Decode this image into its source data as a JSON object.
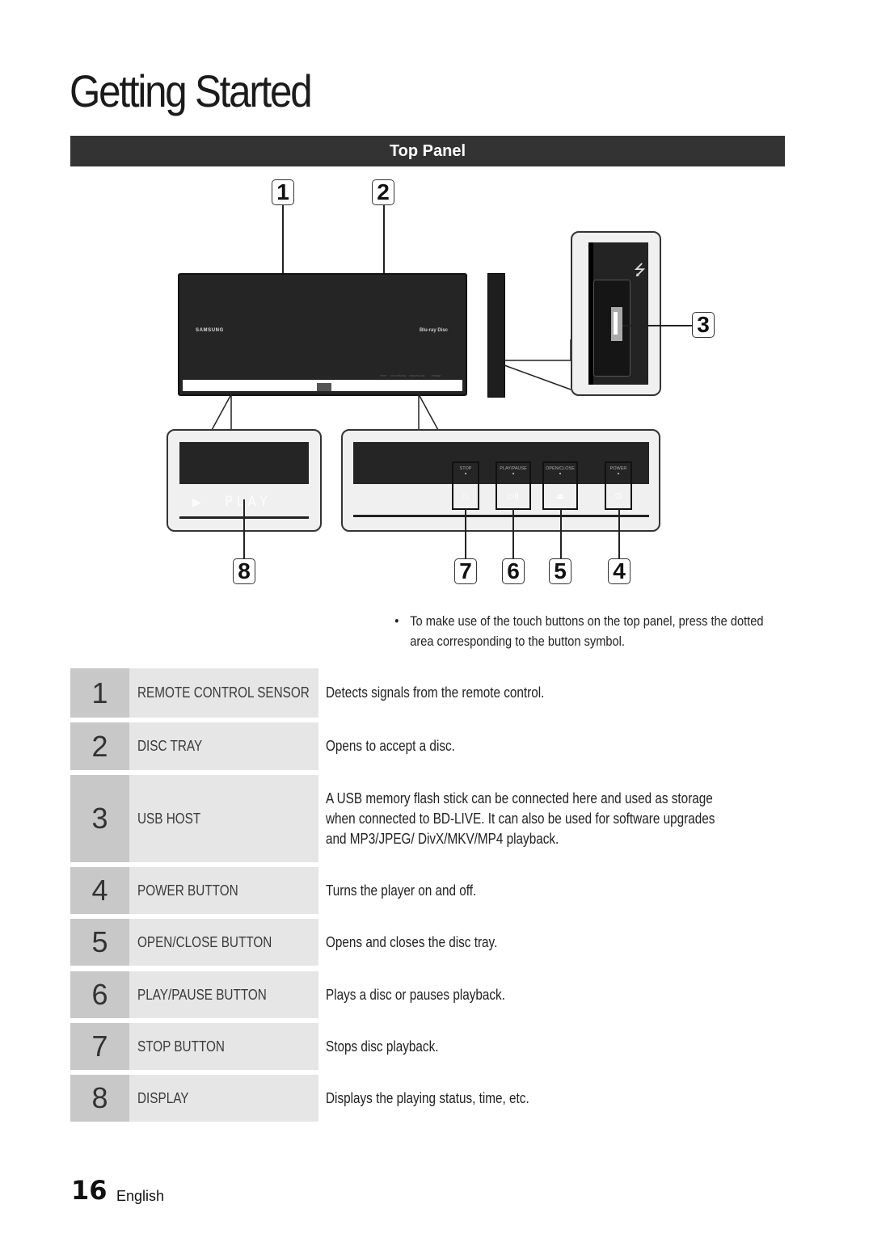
{
  "page": {
    "title": "Getting Started",
    "section": "Top Panel",
    "page_number": "16",
    "language": "English"
  },
  "diagram": {
    "callouts": [
      "1",
      "2",
      "3",
      "4",
      "5",
      "6",
      "7",
      "8"
    ],
    "device_brand": "SAMSUNG",
    "bd_logo": "Blu-ray Disc",
    "display_text": "PLAY",
    "display_arrow": "▶",
    "usb_icon": "⭍",
    "touch_buttons": [
      {
        "label": "STOP",
        "symbol": "□"
      },
      {
        "label": "PLAY/PAUSE",
        "symbol": "▷II"
      },
      {
        "label": "OPEN/CLOSE",
        "symbol": "⏏"
      },
      {
        "label": "POWER",
        "symbol": "⏻"
      }
    ],
    "panel_tiny_labels": [
      "STOP",
      "PLAY/PAUSE",
      "OPEN/CLOSE",
      "POWER"
    ]
  },
  "note": {
    "bullet": "•",
    "text": "To make use of the touch buttons on the top panel, press the dotted area corresponding to the button symbol."
  },
  "table": {
    "rows": [
      {
        "num": "1",
        "name": "REMOTE CONTROL SENSOR",
        "desc": "Detects signals from the remote control."
      },
      {
        "num": "2",
        "name": "DISC TRAY",
        "desc": "Opens to accept a disc."
      },
      {
        "num": "3",
        "name": "USB HOST",
        "desc": "A USB memory flash stick can be connected here and used as storage when connected to BD-LIVE. It can also be used for software upgrades and MP3/JPEG/ DivX/MKV/MP4 playback."
      },
      {
        "num": "4",
        "name": "POWER BUTTON",
        "desc": "Turns the player on and off."
      },
      {
        "num": "5",
        "name": "OPEN/CLOSE BUTTON",
        "desc": "Opens and closes the disc tray."
      },
      {
        "num": "6",
        "name": "PLAY/PAUSE BUTTON",
        "desc": "Plays a disc or pauses playback."
      },
      {
        "num": "7",
        "name": "STOP BUTTON",
        "desc": "Stops disc playback."
      },
      {
        "num": "8",
        "name": "DISPLAY",
        "desc": "Displays the playing status, time, etc."
      }
    ]
  }
}
